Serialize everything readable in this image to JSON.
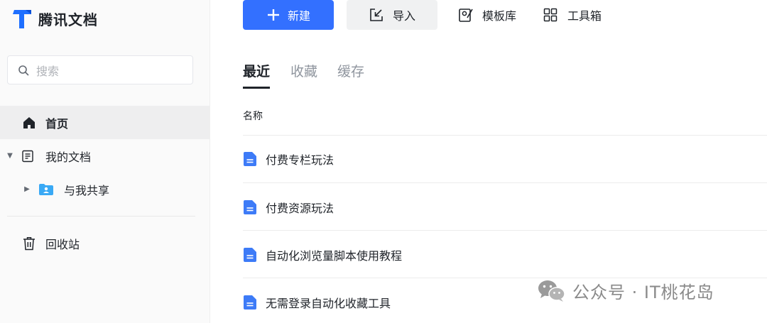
{
  "app": {
    "name": "腾讯文档"
  },
  "sidebar": {
    "search_placeholder": "搜索",
    "items": [
      {
        "label": "首页",
        "icon": "home-icon",
        "active": true
      },
      {
        "label": "我的文档",
        "icon": "document-icon",
        "expanded": true
      },
      {
        "label": "与我共享",
        "icon": "shared-folder-icon",
        "expanded": false
      },
      {
        "label": "回收站",
        "icon": "trash-icon"
      }
    ]
  },
  "toolbar": {
    "new_label": "新建",
    "import_label": "导入",
    "templates_label": "模板库",
    "toolbox_label": "工具箱"
  },
  "tabs": [
    {
      "label": "最近",
      "active": true
    },
    {
      "label": "收藏"
    },
    {
      "label": "缓存"
    }
  ],
  "list": {
    "column_name": "名称",
    "rows": [
      {
        "name": "付费专栏玩法"
      },
      {
        "name": "付费资源玩法"
      },
      {
        "name": "自动化浏览量脚本使用教程"
      },
      {
        "name": "无需登录自动化收藏工具"
      }
    ]
  },
  "watermark": {
    "text": "公众号 · IT桃花岛"
  },
  "colors": {
    "accent": "#3370ff",
    "doc_icon": "#3d7bf7"
  }
}
